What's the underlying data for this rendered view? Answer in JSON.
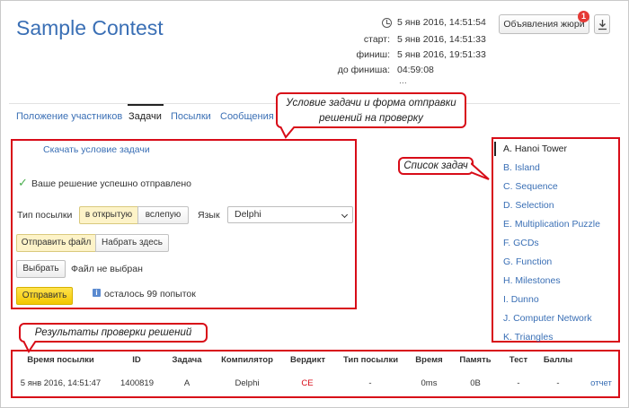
{
  "contest": {
    "title": "Sample Contest"
  },
  "time_info": {
    "now": "5 янв 2016, 14:51:54",
    "start_label": "старт:",
    "start": "5 янв 2016, 14:51:33",
    "finish_label": "финиш:",
    "finish": "5 янв 2016, 19:51:33",
    "remaining_label": "до финиша:",
    "remaining": "04:59:08",
    "ellipsis": "..."
  },
  "header": {
    "announcements_label": "Объявления жюри",
    "announcements_count": "1"
  },
  "tabs": [
    {
      "label": "Положение участников"
    },
    {
      "label": "Задачи"
    },
    {
      "label": "Посылки"
    },
    {
      "label": "Сообщения"
    }
  ],
  "callouts": {
    "statement": "Условие задачи и форма отправки решений на проверку",
    "task_list": "Список задач",
    "results": "Результаты проверки решений"
  },
  "submit_form": {
    "download_statement": "Скачать условие задачи",
    "success_message": "Ваше решение успешно отправлено",
    "type_label": "Тип посылки",
    "type_open": "в открытую",
    "type_blind": "вслепую",
    "language_label": "Язык",
    "language_value": "Delphi",
    "send_file": "Отправить файл",
    "type_here": "Набрать здесь",
    "choose_file": "Выбрать",
    "no_file": "Файл не выбран",
    "submit": "Отправить",
    "attempts_left": "осталось 99 попыток"
  },
  "tasks": [
    "A. Hanoi Tower",
    "B. Island",
    "C. Sequence",
    "D. Selection",
    "E. Multiplication Puzzle",
    "F. GCDs",
    "G. Function",
    "H. Milestones",
    "I. Dunno",
    "J. Computer Network",
    "K. Triangles"
  ],
  "results": {
    "columns": [
      "Время посылки",
      "ID",
      "Задача",
      "Компилятор",
      "Вердикт",
      "Тип посылки",
      "Время",
      "Память",
      "Тест",
      "Баллы"
    ],
    "rows": [
      {
        "time": "5 янв 2016, 14:51:47",
        "id": "1400819",
        "task": "A",
        "compiler": "Delphi",
        "verdict": "CE",
        "type": "-",
        "run_time": "0ms",
        "memory": "0B",
        "test": "-",
        "score": "-",
        "report": "отчет"
      }
    ]
  },
  "colors": {
    "accent": "#3a6fb5",
    "highlight": "#d80c18",
    "submit_button": "#f3c700"
  }
}
